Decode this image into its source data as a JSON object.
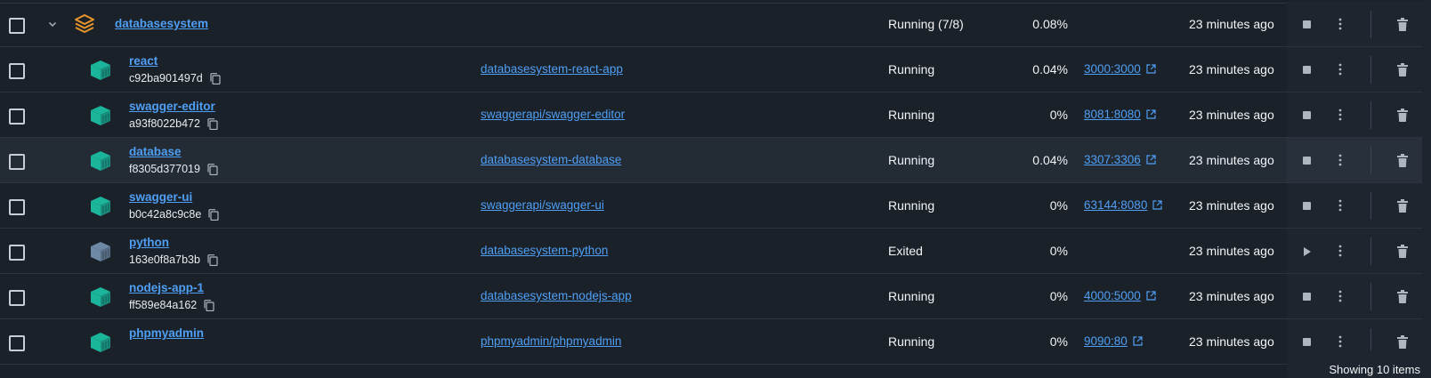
{
  "group": {
    "name": "databasesystem",
    "status": "Running (7/8)",
    "cpu": "0.08%",
    "last_started": "23 minutes ago",
    "icon": "stack-layers-icon"
  },
  "containers": [
    {
      "name": "react",
      "id": "c92ba901497d",
      "image": "databasesystem-react-app",
      "status": "Running",
      "cpu": "0.04%",
      "port": "3000:3000",
      "last_started": "23 minutes ago",
      "state": "running"
    },
    {
      "name": "swagger-editor",
      "id": "a93f8022b472",
      "image": "swaggerapi/swagger-editor",
      "status": "Running",
      "cpu": "0%",
      "port": "8081:8080",
      "last_started": "23 minutes ago",
      "state": "running"
    },
    {
      "name": "database",
      "id": "f8305d377019",
      "image": "databasesystem-database",
      "status": "Running",
      "cpu": "0.04%",
      "port": "3307:3306",
      "last_started": "23 minutes ago",
      "state": "running"
    },
    {
      "name": "swagger-ui",
      "id": "b0c42a8c9c8e",
      "image": "swaggerapi/swagger-ui",
      "status": "Running",
      "cpu": "0%",
      "port": "63144:8080",
      "last_started": "23 minutes ago",
      "state": "running"
    },
    {
      "name": "python",
      "id": "163e0f8a7b3b",
      "image": "databasesystem-python",
      "status": "Exited",
      "cpu": "0%",
      "port": "",
      "last_started": "23 minutes ago",
      "state": "exited"
    },
    {
      "name": "nodejs-app-1",
      "id": "ff589e84a162",
      "image": "databasesystem-nodejs-app",
      "status": "Running",
      "cpu": "0%",
      "port": "4000:5000",
      "last_started": "23 minutes ago",
      "state": "running"
    },
    {
      "name": "phpmyadmin",
      "id": "",
      "image": "phpmyadmin/phpmyadmin",
      "status": "Running",
      "cpu": "0%",
      "port": "9090:80",
      "last_started": "23 minutes ago",
      "state": "running"
    }
  ],
  "footer": {
    "text": "Showing 10 items"
  },
  "colors": {
    "accent": "#4f9ff5",
    "group_icon": "#e8952b",
    "running_icon": "#1ab59b",
    "exited_icon": "#6e89a6",
    "background": "#1b2129"
  }
}
